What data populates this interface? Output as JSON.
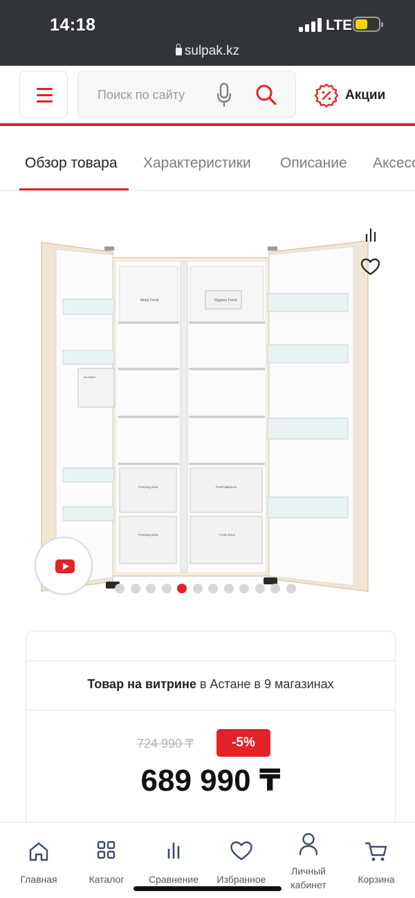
{
  "status_bar": {
    "time": "14:18",
    "network": "LTE",
    "url": "sulpak.kz",
    "battery_level": 0.45,
    "battery_color": "#f5d50a"
  },
  "header": {
    "search_placeholder": "Поиск по сайту",
    "promo_label": "Акции",
    "accent_color": "#e4222a"
  },
  "tabs": [
    {
      "label": "Обзор товара",
      "active": true
    },
    {
      "label": "Характеристики",
      "active": false
    },
    {
      "label": "Описание",
      "active": false
    },
    {
      "label": "Аксессуары",
      "active": false
    }
  ],
  "gallery": {
    "image_count": 12,
    "active_index": 4,
    "icons": [
      "compare-icon",
      "heart-icon",
      "youtube-play-icon"
    ]
  },
  "fridge_labels": {
    "shelf_left": "Metal Fresh",
    "shelf_right": "Hygiene Fresh",
    "drawer_tl": "Freezing Zone",
    "drawer_tr": "Fresh Balancer",
    "drawer_bl": "Freezing Zone",
    "drawer_br": "Fresh Zone",
    "dispenser": "Ice Maker"
  },
  "product": {
    "availability_bold": "Товар на витрине",
    "availability_rest": " в Астане в 9 магазинах",
    "old_price": "724 990 ₸",
    "discount": "-5%",
    "price": "689 990 ₸"
  },
  "bottom_nav": [
    {
      "label": "Главная",
      "icon": "home-icon"
    },
    {
      "label": "Каталог",
      "icon": "grid-icon"
    },
    {
      "label": "Сравнение",
      "icon": "compare-icon"
    },
    {
      "label": "Избранное",
      "icon": "heart-icon"
    },
    {
      "label": "Личный кабинет",
      "icon": "user-icon"
    },
    {
      "label": "Корзина",
      "icon": "cart-icon"
    }
  ]
}
